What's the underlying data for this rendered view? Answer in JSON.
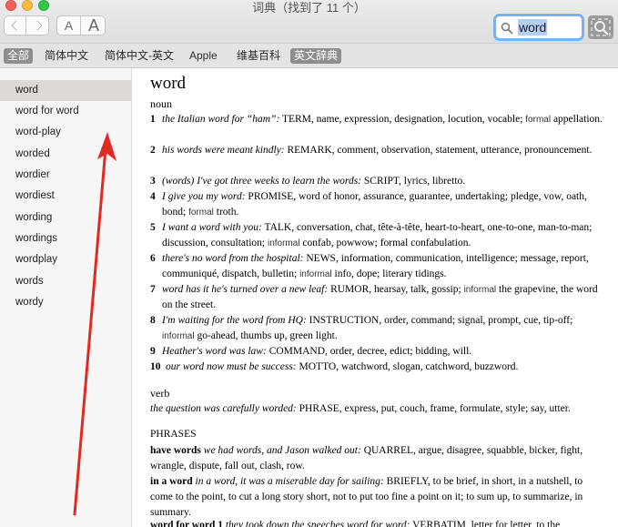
{
  "window": {
    "title": "词典（找到了 11 个）"
  },
  "toolbar": {
    "font_smaller": "A",
    "font_larger": "A"
  },
  "search": {
    "value": "word"
  },
  "tabs": [
    "全部",
    "简体中文",
    "简体中文-英文",
    "Apple",
    "维基百科",
    "英文辞典"
  ],
  "sidebar": {
    "items": [
      "word",
      "word for word",
      "word-play",
      "worded",
      "wordier",
      "wordiest",
      "wording",
      "wordings",
      "wordplay",
      "words",
      "wordy"
    ]
  },
  "entry": {
    "headword": "word",
    "pos_noun": "noun",
    "senses": [
      {
        "num": "1",
        "ex": "the Italian word for “ham”:",
        "text": " TERM, name, expression, designation, locution, vocable; ",
        "reg": "formal",
        "tail": " appellation."
      },
      {
        "num": "2",
        "ex": "his words were meant kindly:",
        "text": " REMARK, comment, observation, statement, utterance, pronouncement.",
        "reg": "",
        "tail": ""
      },
      {
        "num": "3",
        "ex": "(words) I've got three weeks to learn the words:",
        "text": " SCRIPT, lyrics, libretto.",
        "reg": "",
        "tail": ""
      },
      {
        "num": "4",
        "ex": "I give you my word:",
        "text": " PROMISE, word of honor, assurance, guarantee, undertaking; pledge, vow, oath, bond; ",
        "reg": "formal",
        "tail": " troth."
      },
      {
        "num": "5",
        "ex": "I want a word with you:",
        "text": " TALK, conversation, chat, tête-à-tête, heart-to-heart, one-to-one, man-to-man; discussion, consultation; ",
        "reg": "informal",
        "tail": " confab, powwow; formal confabulation."
      },
      {
        "num": "6",
        "ex": "there's no word from the hospital:",
        "text": " NEWS, information, communication, intelligence; message, report, communiqué, dispatch, bulletin; ",
        "reg": "informal",
        "tail": " info, dope; literary tidings."
      },
      {
        "num": "7",
        "ex": "word has it he's turned over a new leaf:",
        "text": " RUMOR, hearsay, talk, gossip; ",
        "reg": "informal",
        "tail": " the grapevine, the word on the street."
      },
      {
        "num": "8",
        "ex": "I'm waiting for the word from HQ:",
        "text": " INSTRUCTION, order, command; signal, prompt, cue, tip-off; ",
        "reg": "informal",
        "tail": " go-ahead, thumbs up, green light."
      },
      {
        "num": "9",
        "ex": "Heather's word was law:",
        "text": " COMMAND, order, decree, edict; bidding, will.",
        "reg": "",
        "tail": ""
      },
      {
        "num": "10",
        "ex": "our word now must be success:",
        "text": " MOTTO, watchword, slogan, catchword, buzzword.",
        "reg": "",
        "tail": ""
      }
    ],
    "pos_verb": "verb",
    "verb_sense": {
      "ex": "the question was carefully worded:",
      "text": " PHRASE, express, put, couch, frame, formulate, style; say, utter."
    },
    "phrases_head": "PHRASES",
    "phrases": [
      {
        "key": "have words",
        "ex": " we had words, and Jason walked out:",
        "text": " QUARREL, argue, disagree, squabble, bicker, fight, wrangle, dispute, fall out, clash, row."
      },
      {
        "key": "in a word",
        "ex": " in a word, it was a miserable day for sailing:",
        "text": " BRIEFLY, to be brief, in short, in a nutshell, to come to the point, to cut a long story short, not to put too fine a point on it; to sum up, to summarize, in summary."
      },
      {
        "key": "word for word 1",
        "ex": " they took down the speeches word for word:",
        "text": " VERBATIM, letter for letter, to the"
      }
    ]
  }
}
